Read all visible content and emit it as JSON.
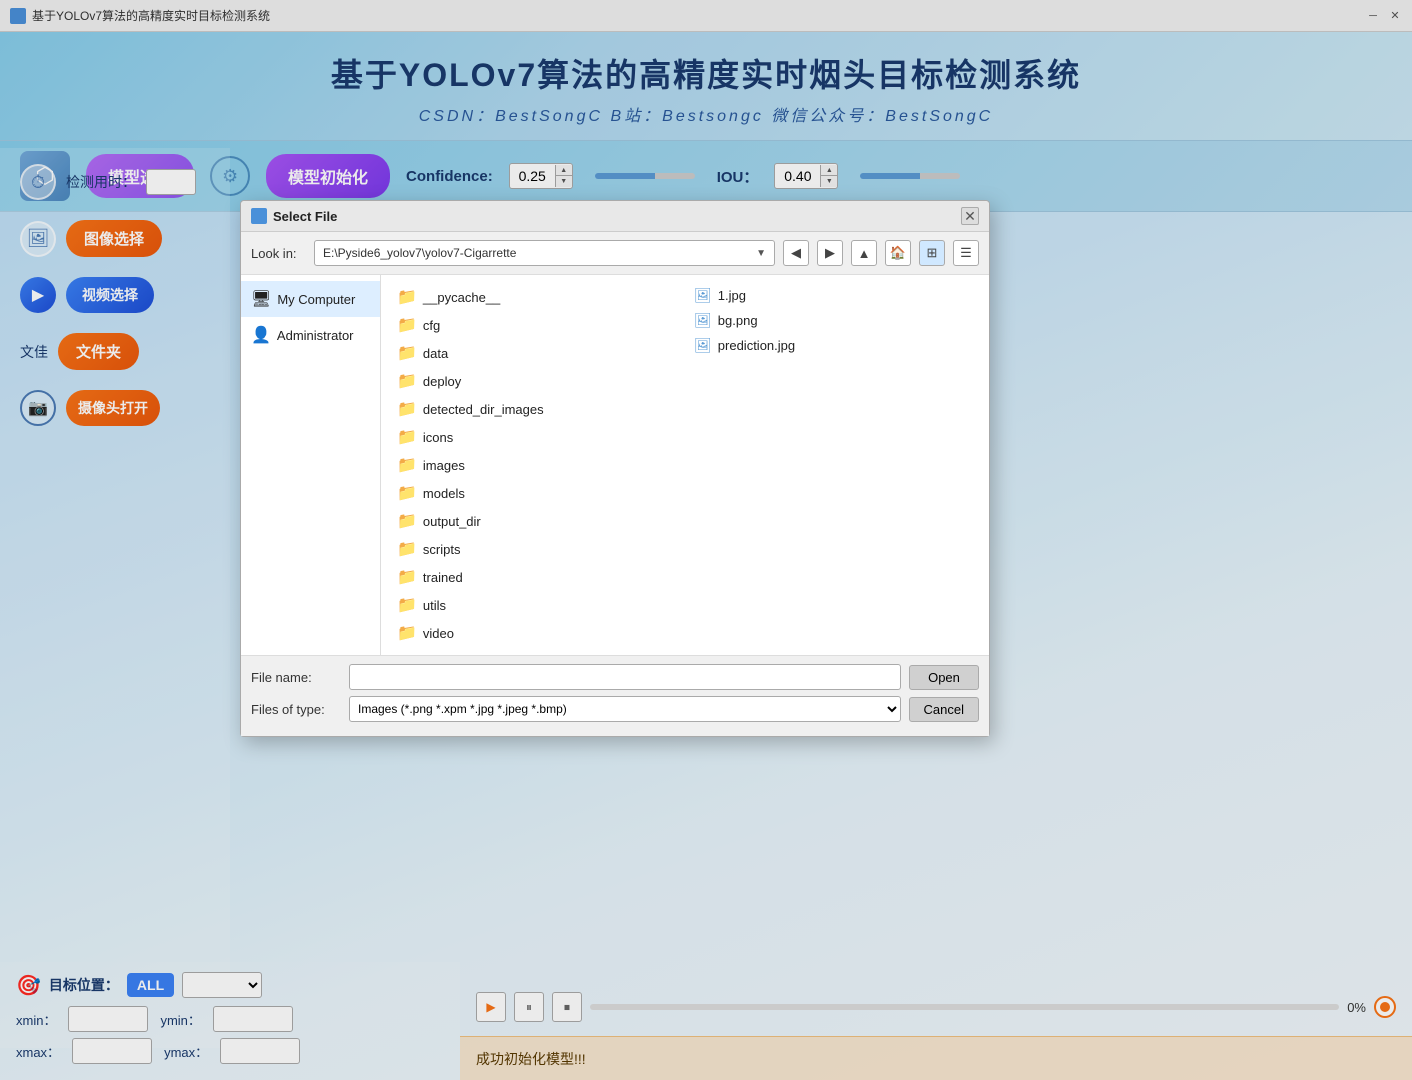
{
  "window": {
    "title": "基于YOLOv7算法的高精度实时目标检测系统",
    "close_icon": "✕",
    "minimize_icon": "─"
  },
  "header": {
    "title": "基于YOLOv7算法的高精度实时烟头目标检测系统",
    "subtitle": "CSDN：BestSongC   B站：Bestsongc   微信公众号：BestSongC"
  },
  "toolbar": {
    "model_select_label": "模型选择",
    "model_init_label": "模型初始化",
    "confidence_label": "Confidence:",
    "confidence_value": "0.25",
    "iou_label": "IOU：",
    "iou_value": "0.40"
  },
  "left_panel": {
    "detect_time_label": "检测用时：",
    "image_select_label": "图像选择",
    "video_select_label": "视频选择",
    "folder_label": "文佳",
    "folder_btn": "文件夹",
    "camera_label": "摄像头打开"
  },
  "target": {
    "label": "目标位置：",
    "all_btn": "ALL",
    "xmin_label": "xmin：",
    "ymin_label": "ymin：",
    "xmax_label": "xmax：",
    "ymax_label": "ymax："
  },
  "playbar": {
    "percent": "0%"
  },
  "status": {
    "message": "成功初始化模型!!!"
  },
  "dialog": {
    "title": "Select File",
    "lookin_label": "Look in:",
    "lookin_path": "E:\\Pyside6_yolov7\\yolov7-Cigarrette",
    "bookmarks": [
      {
        "label": "My Computer",
        "icon": "🖥"
      },
      {
        "label": "Administrator",
        "icon": "👤"
      }
    ],
    "folders": [
      "__pycache__",
      "cfg",
      "data",
      "deploy",
      "detected_dir_images",
      "icons",
      "images",
      "models",
      "output_dir",
      "scripts",
      "trained",
      "utils",
      "video"
    ],
    "files": [
      {
        "name": "1.jpg",
        "type": "image"
      },
      {
        "name": "bg.png",
        "type": "image"
      },
      {
        "name": "prediction.jpg",
        "type": "image"
      }
    ],
    "filename_label": "File name:",
    "filetype_label": "Files of type:",
    "filetype_value": "Images (*.png *.xpm *.jpg *.jpeg *.bmp)",
    "open_btn": "Open",
    "cancel_btn": "Cancel"
  }
}
